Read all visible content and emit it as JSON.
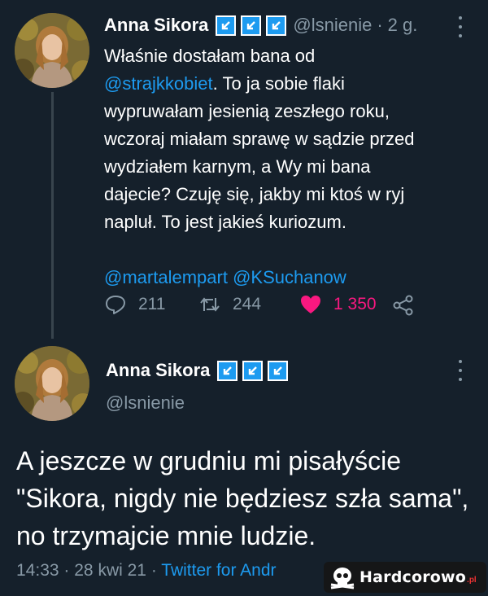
{
  "tweet1": {
    "author_name": "Anna Sikora",
    "handle": "@lsnienie",
    "separator": "·",
    "time": "2 g.",
    "text_lines": [
      "Właśnie dostałam bana od",
      "To ja sobie flaki",
      "wypruwałam jesienią zeszłego roku,",
      "wczoraj miałam sprawę w sądzie przed",
      "wydziałem karnym, a Wy mi bana",
      "dajecie? Czuję się, jakby mi ktoś w ryj",
      "napluł. To jest jakieś kuriozum."
    ],
    "inline_mention": "@strajkkobiet",
    "mentions": [
      "@martalempart",
      "@KSuchanow"
    ],
    "actions": {
      "replies": "211",
      "retweets": "244",
      "likes": "1 350"
    },
    "icons": [
      "reply-icon",
      "retweet-icon",
      "heart-icon",
      "share-icon",
      "more-icon",
      "verified-badge-icon"
    ],
    "like_color": "#f91880"
  },
  "tweet2": {
    "author_name": "Anna Sikora",
    "handle": "@lsnienie",
    "text": "A jeszcze w grudniu mi pisałyście \"Sikora, nigdy nie będziesz szła sama\", no trzymajcie mnie ludzie.",
    "meta": {
      "time": "14:33",
      "sep1": "·",
      "date": "28 kwi 21",
      "sep2": "·",
      "client": "Twitter for Andr"
    }
  },
  "watermark": {
    "text": "Hardcorowo",
    "tld": ".pl",
    "icon": "skull-icon"
  },
  "colors": {
    "background": "#15202b",
    "link": "#1d9bf0",
    "secondary": "#8899a6",
    "like": "#f91880"
  }
}
